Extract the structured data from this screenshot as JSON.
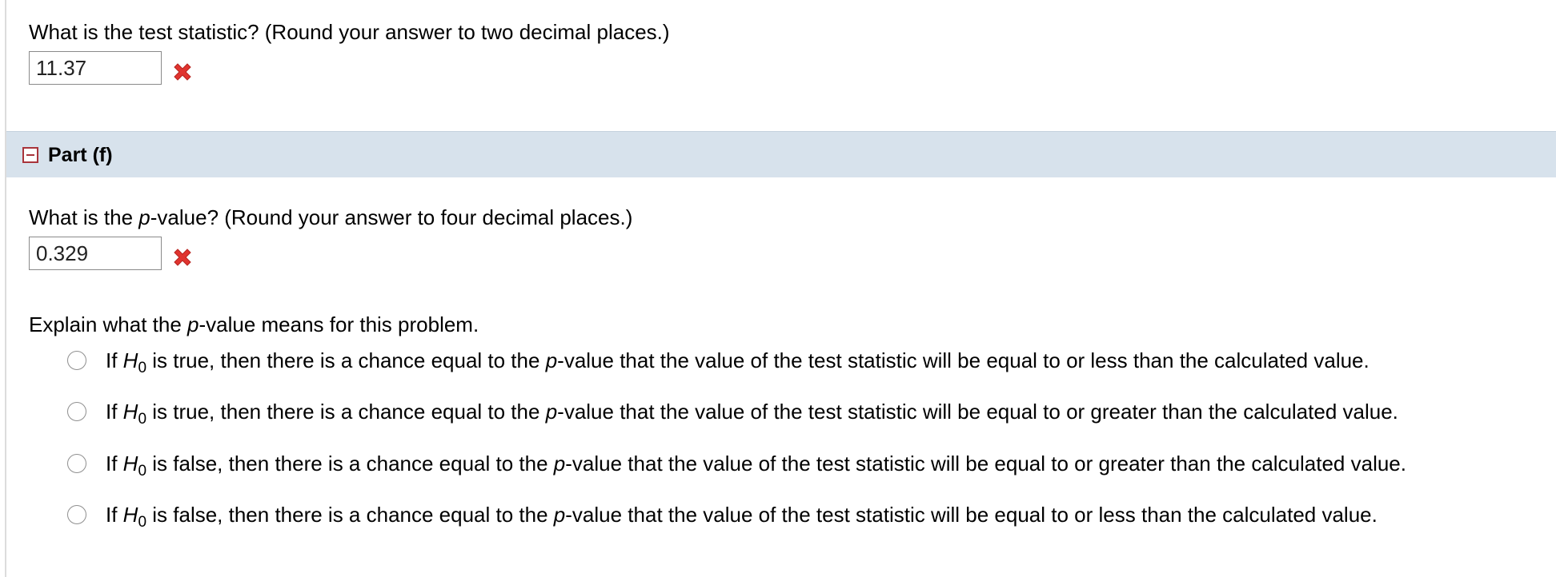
{
  "part_e": {
    "question": "What is the test statistic? (Round your answer to two decimal places.)",
    "answer_value": "11.37",
    "result_icon": "x-mark-icon",
    "result_color": "#e0342f"
  },
  "part_f": {
    "header": {
      "title": "Part (f)",
      "toggle_icon": "collapse-minus-icon",
      "background": "#d7e2ec"
    },
    "pvalue_question": {
      "prefix": "What is the ",
      "p_symbol": "p",
      "suffix": "-value? (Round your answer to four decimal places.)"
    },
    "pvalue_answer": "0.329",
    "explain_prompt": {
      "prefix": "Explain what the ",
      "p_symbol": "p",
      "suffix": "-value means for this problem."
    },
    "options": [
      {
        "if": "If ",
        "h": "H",
        "sub": "0",
        "mid": " is true, then there is a chance equal to the ",
        "p": "p",
        "end": "-value that the value of the test statistic will be equal to or less than the calculated value."
      },
      {
        "if": "If ",
        "h": "H",
        "sub": "0",
        "mid": " is true, then there is a chance equal to the ",
        "p": "p",
        "end": "-value that the value of the test statistic will be equal to or greater than the calculated value."
      },
      {
        "if": "If ",
        "h": "H",
        "sub": "0",
        "mid": " is false, then there is a chance equal to the ",
        "p": "p",
        "end": "-value that the value of the test statistic will be equal to or greater than the calculated value."
      },
      {
        "if": "If ",
        "h": "H",
        "sub": "0",
        "mid": " is false, then there is a chance equal to the ",
        "p": "p",
        "end": "-value that the value of the test statistic will be equal to or less than the calculated value."
      }
    ]
  }
}
